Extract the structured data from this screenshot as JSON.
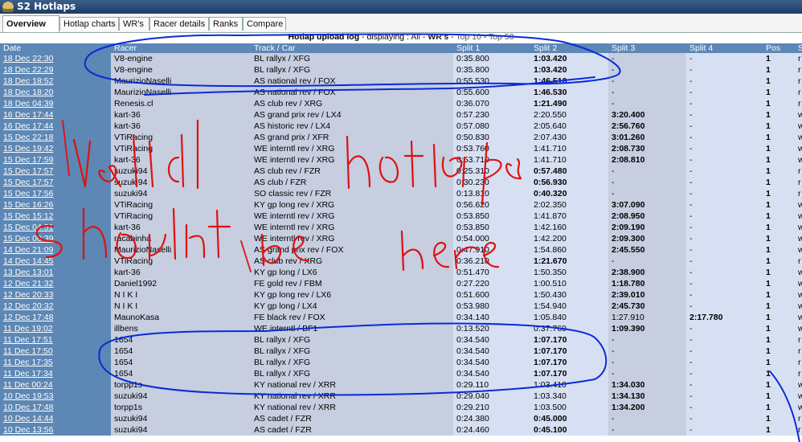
{
  "window": {
    "title": "S2 Hotlaps"
  },
  "tabs": [
    {
      "label": "Overview",
      "active": true
    },
    {
      "label": "Hotlap charts",
      "active": false
    },
    {
      "label": "WR's",
      "active": false
    },
    {
      "label": "Racer details",
      "active": false
    },
    {
      "label": "Ranks",
      "active": false
    },
    {
      "label": "Compare",
      "active": false
    }
  ],
  "subheader": {
    "title": "Hotlap upload log",
    "displaying": " - displaying : ",
    "all": "All",
    "sep": " - ",
    "wrs": "WR's",
    "top10": "Top 10",
    "top50": "Top 50"
  },
  "columns": [
    "Date",
    "Racer",
    "Track / Car",
    "Split 1",
    "Split 2",
    "Split 3",
    "Split 4",
    "Pos",
    "S"
  ],
  "rows": [
    {
      "date": "18 Dec 22:30",
      "racer": "V8-engine",
      "track": "BL rallyx / XFG",
      "split1": "0:35.800",
      "split2": "1:03.420",
      "split3": "-",
      "split4": "-",
      "pos": "1",
      "last": "r"
    },
    {
      "date": "18 Dec 22:29",
      "racer": "V8-engine",
      "track": "BL rallyx / XFG",
      "split1": "0:35.800",
      "split2": "1:03.420",
      "split3": "-",
      "split4": "-",
      "pos": "1",
      "last": "r"
    },
    {
      "date": "18 Dec 18:52",
      "racer": "MaurizioNaselli",
      "track": "AS national rev / FOX",
      "split1": "0:55.530",
      "split2": "1:46.510",
      "split3": "-",
      "split4": "-",
      "pos": "1",
      "last": "r"
    },
    {
      "date": "18 Dec 18:20",
      "racer": "MaurizioNaselli",
      "track": "AS national rev / FOX",
      "split1": "0:55.600",
      "split2": "1:46.530",
      "split3": "-",
      "split4": "-",
      "pos": "1",
      "last": "r"
    },
    {
      "date": "18 Dec 04:39",
      "racer": "Renesis.cl",
      "track": "AS club rev / XRG",
      "split1": "0:36.070",
      "split2": "1:21.490",
      "split3": "-",
      "split4": "-",
      "pos": "1",
      "last": "r"
    },
    {
      "date": "16 Dec 17:44",
      "racer": "kart-36",
      "track": "AS grand prix rev / LX4",
      "split1": "0:57.230",
      "split2": "2:20.550",
      "split3": "3:20.400",
      "split4": "-",
      "pos": "1",
      "last": "w"
    },
    {
      "date": "16 Dec 17:44",
      "racer": "kart-36",
      "track": "AS historic rev / LX4",
      "split1": "0:57.080",
      "split2": "2:05.640",
      "split3": "2:56.760",
      "split4": "-",
      "pos": "1",
      "last": "w"
    },
    {
      "date": "15 Dec 22:18",
      "racer": "VTiRacing",
      "track": "AS grand prix / XFR",
      "split1": "0:50.830",
      "split2": "2:07.430",
      "split3": "3:01.260",
      "split4": "-",
      "pos": "1",
      "last": "w"
    },
    {
      "date": "15 Dec 19:42",
      "racer": "VTiRacing",
      "track": "WE interntl rev / XRG",
      "split1": "0:53.760",
      "split2": "1:41.710",
      "split3": "2:08.730",
      "split4": "-",
      "pos": "1",
      "last": "w"
    },
    {
      "date": "15 Dec 17:59",
      "racer": "kart-36",
      "track": "WE interntl rev / XRG",
      "split1": "0:53.710",
      "split2": "1:41.710",
      "split3": "2:08.810",
      "split4": "-",
      "pos": "1",
      "last": "w"
    },
    {
      "date": "15 Dec 17:57",
      "racer": "suzuki94",
      "track": "AS club rev / FZR",
      "split1": "0:25.310",
      "split2": "0:57.480",
      "split3": "-",
      "split4": "-",
      "pos": "1",
      "last": "r"
    },
    {
      "date": "15 Dec 17:57",
      "racer": "suzuki94",
      "track": "AS club / FZR",
      "split1": "0:30.230",
      "split2": "0:56.930",
      "split3": "-",
      "split4": "-",
      "pos": "1",
      "last": "r"
    },
    {
      "date": "15 Dec 17:56",
      "racer": "suzuki94",
      "track": "SO classic rev / FZR",
      "split1": "0:13.810",
      "split2": "0:40.320",
      "split3": "-",
      "split4": "-",
      "pos": "1",
      "last": "r"
    },
    {
      "date": "15 Dec 16:26",
      "racer": "VTiRacing",
      "track": "KY gp long rev / XRG",
      "split1": "0:56.620",
      "split2": "2:02.350",
      "split3": "3:07.090",
      "split4": "-",
      "pos": "1",
      "last": "w"
    },
    {
      "date": "15 Dec 15:12",
      "racer": "VTiRacing",
      "track": "WE interntl rev / XRG",
      "split1": "0:53.850",
      "split2": "1:41.870",
      "split3": "2:08.950",
      "split4": "-",
      "pos": "1",
      "last": "w"
    },
    {
      "date": "15 Dec 04:51",
      "racer": "kart-36",
      "track": "WE interntl rev / XRG",
      "split1": "0:53.850",
      "split2": "1:42.160",
      "split3": "2:09.190",
      "split4": "-",
      "pos": "1",
      "last": "w"
    },
    {
      "date": "15 Dec 00:39",
      "racer": "racabinha",
      "track": "WE interntl rev / XRG",
      "split1": "0:54.000",
      "split2": "1:42.200",
      "split3": "2:09.300",
      "split4": "-",
      "pos": "1",
      "last": "w"
    },
    {
      "date": "14 Dec 21:09",
      "racer": "MaurizioNaselli",
      "track": "AS grand prix rev / FOX",
      "split1": "0:47.910",
      "split2": "1:54.860",
      "split3": "2:45.550",
      "split4": "-",
      "pos": "1",
      "last": "w"
    },
    {
      "date": "14 Dec 14:45",
      "racer": "VTiRacing",
      "track": "AS club rev / XRG",
      "split1": "0:36.210",
      "split2": "1:21.670",
      "split3": "-",
      "split4": "-",
      "pos": "1",
      "last": "r"
    },
    {
      "date": "13 Dec 13:01",
      "racer": "kart-36",
      "track": "KY gp long / LX6",
      "split1": "0:51.470",
      "split2": "1:50.350",
      "split3": "2:38.900",
      "split4": "-",
      "pos": "1",
      "last": "w"
    },
    {
      "date": "12 Dec 21:32",
      "racer": "Daniel1992",
      "track": "FE gold rev / FBM",
      "split1": "0:27.220",
      "split2": "1:00.510",
      "split3": "1:18.780",
      "split4": "-",
      "pos": "1",
      "last": "w"
    },
    {
      "date": "12 Dec 20:33",
      "racer": "N I K I",
      "track": "KY gp long rev / LX6",
      "split1": "0:51.600",
      "split2": "1:50.430",
      "split3": "2:39.010",
      "split4": "-",
      "pos": "1",
      "last": "w"
    },
    {
      "date": "12 Dec 20:32",
      "racer": "N I K I",
      "track": "KY gp long / LX4",
      "split1": "0:53.980",
      "split2": "1:54.940",
      "split3": "2:45.730",
      "split4": "-",
      "pos": "1",
      "last": "w"
    },
    {
      "date": "12 Dec 17:48",
      "racer": "MaunoKasa",
      "track": "FE black rev / FOX",
      "split1": "0:34.140",
      "split2": "1:05.840",
      "split3": "1:27.910",
      "split4": "2:17.780",
      "pos": "1",
      "last": "w"
    },
    {
      "date": "11 Dec 19:02",
      "racer": "illbens",
      "track": "WE interntl / BF1",
      "split1": "0:13.520",
      "split2": "0:37.760",
      "split3": "1:09.390",
      "split4": "-",
      "pos": "1",
      "last": "w"
    },
    {
      "date": "11 Dec 17:51",
      "racer": "1654",
      "track": "BL rallyx / XFG",
      "split1": "0:34.540",
      "split2": "1:07.170",
      "split3": "-",
      "split4": "-",
      "pos": "1",
      "last": "r"
    },
    {
      "date": "11 Dec 17:50",
      "racer": "1654",
      "track": "BL rallyx / XFG",
      "split1": "0:34.540",
      "split2": "1:07.170",
      "split3": "-",
      "split4": "-",
      "pos": "1",
      "last": "r"
    },
    {
      "date": "11 Dec 17:35",
      "racer": "1654",
      "track": "BL rallyx / XFG",
      "split1": "0:34.540",
      "split2": "1:07.170",
      "split3": "-",
      "split4": "-",
      "pos": "1",
      "last": "r"
    },
    {
      "date": "11 Dec 17:34",
      "racer": "1654",
      "track": "BL rallyx / XFG",
      "split1": "0:34.540",
      "split2": "1:07.170",
      "split3": "-",
      "split4": "-",
      "pos": "1",
      "last": "r"
    },
    {
      "date": "11 Dec 00:24",
      "racer": "torpp1s",
      "track": "KY national rev / XRR",
      "split1": "0:29.110",
      "split2": "1:03.410",
      "split3": "1:34.030",
      "split4": "-",
      "pos": "1",
      "last": "w"
    },
    {
      "date": "10 Dec 19:53",
      "racer": "suzuki94",
      "track": "KY national rev / XRR",
      "split1": "0:29.040",
      "split2": "1:03.340",
      "split3": "1:34.130",
      "split4": "-",
      "pos": "1",
      "last": "w"
    },
    {
      "date": "10 Dec 17:48",
      "racer": "torpp1s",
      "track": "KY national rev / XRR",
      "split1": "0:29.210",
      "split2": "1:03.500",
      "split3": "1:34.200",
      "split4": "-",
      "pos": "1",
      "last": "w"
    },
    {
      "date": "10 Dec 14:44",
      "racer": "suzuki94",
      "track": "AS cadet / FZR",
      "split1": "0:24.380",
      "split2": "0:45.000",
      "split3": "-",
      "split4": "-",
      "pos": "1",
      "last": "r"
    },
    {
      "date": "10 Dec 13:56",
      "racer": "suzuki94",
      "track": "AS cadet / FZR",
      "split1": "0:24.460",
      "split2": "0:45.100",
      "split3": "-",
      "split4": "-",
      "pos": "1",
      "last": "r"
    }
  ],
  "annotation": {
    "color": "#0a2ad8",
    "handwriting_color": "#e01010",
    "handwritten_text": "valid hotlaps shouldnt be here"
  }
}
